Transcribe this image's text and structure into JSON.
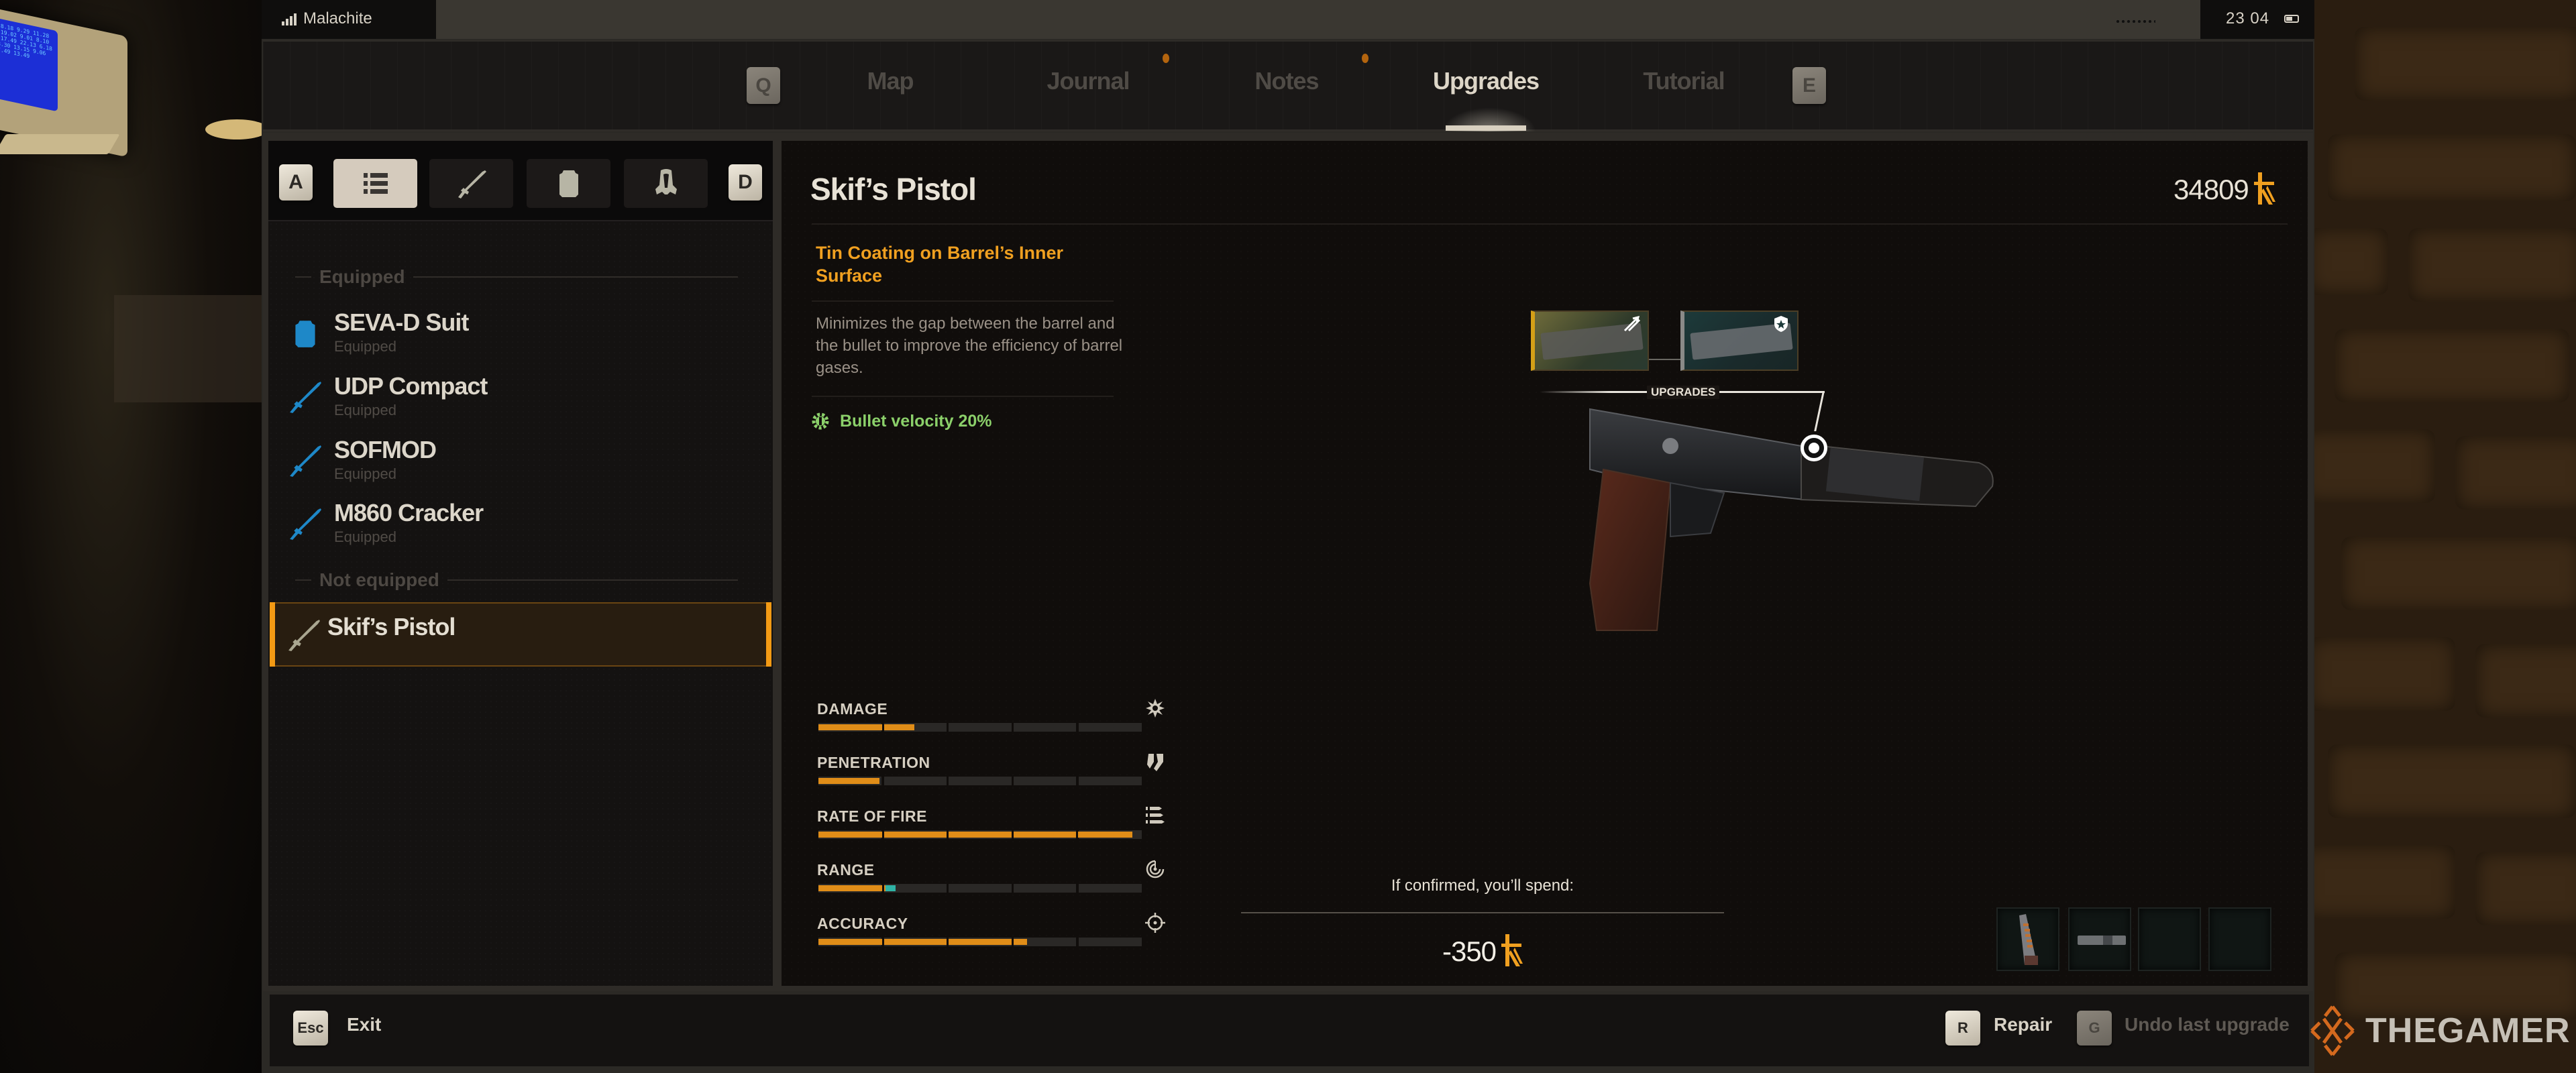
{
  "status_bar": {
    "carrier": "Malachite",
    "signal_icon": "signal-bars-icon",
    "time": "23 04",
    "battery_icon": "battery-icon"
  },
  "nav": {
    "prev_key": "Q",
    "next_key": "E",
    "tabs": [
      {
        "label": "Map",
        "active": false,
        "notification": false
      },
      {
        "label": "Journal",
        "active": false,
        "notification": true
      },
      {
        "label": "Notes",
        "active": false,
        "notification": true
      },
      {
        "label": "Upgrades",
        "active": true,
        "notification": false
      },
      {
        "label": "Tutorial",
        "active": false,
        "notification": false
      }
    ]
  },
  "sidebar": {
    "prev_key": "A",
    "next_key": "D",
    "categories": [
      {
        "name": "all",
        "icon": "list-icon",
        "active": true
      },
      {
        "name": "weapons",
        "icon": "rifle-icon",
        "active": false
      },
      {
        "name": "armor",
        "icon": "vest-icon",
        "active": false
      },
      {
        "name": "helmets",
        "icon": "gas-mask-icon",
        "active": false
      }
    ],
    "sections": [
      {
        "title": "Equipped",
        "items": [
          {
            "name": "SEVA-D Suit",
            "status": "Equipped",
            "icon": "vest-icon"
          },
          {
            "name": "UDP Compact",
            "status": "Equipped",
            "icon": "rifle-icon"
          },
          {
            "name": "SOFMOD",
            "status": "Equipped",
            "icon": "rifle-icon"
          },
          {
            "name": "M860 Cracker",
            "status": "Equipped",
            "icon": "rifle-icon"
          }
        ]
      },
      {
        "title": "Not equipped",
        "items": [
          {
            "name": "Skif’s Pistol",
            "status": "",
            "icon": "rifle-icon",
            "selected": true
          }
        ]
      }
    ]
  },
  "main": {
    "title": "Skif’s Pistol",
    "balance": "34809",
    "currency_icon": "coupon-currency-icon",
    "upgrade": {
      "name": "Tin Coating on Barrel’s Inner Surface",
      "description": "Minimizes the gap between the barrel and the bullet to improve the efficiency of barrel gases.",
      "bonus": "Bullet velocity 20%",
      "bonus_icon": "gear-wrench-icon"
    },
    "callout_label": "UPGRADES",
    "upgrade_thumbnails": [
      {
        "name": "barrel-upgrade",
        "badge_icon": "velocity-arrows-icon",
        "selected": true
      },
      {
        "name": "slide-upgrade",
        "badge_icon": "shield-burst-icon",
        "selected": false
      }
    ],
    "stats": [
      {
        "label": "DAMAGE",
        "icon": "explosion-icon",
        "value": 0.3,
        "bonus": 0
      },
      {
        "label": "PENETRATION",
        "icon": "penetration-icon",
        "value": 0.19,
        "bonus": 0
      },
      {
        "label": "RATE OF FIRE",
        "icon": "bullets-icon",
        "value": 0.98,
        "bonus": 0
      },
      {
        "label": "RANGE",
        "icon": "range-icon",
        "value": 0.21,
        "bonus": 0.03
      },
      {
        "label": "ACCURACY",
        "icon": "crosshair-icon",
        "value": 0.65,
        "bonus": 0
      }
    ],
    "stat_segments": 5,
    "cost": {
      "label": "If confirmed, you’ll spend:",
      "value": "-350"
    },
    "attachment_slots": [
      {
        "item": "magazine",
        "filled": true
      },
      {
        "item": "suppressor",
        "filled": true
      },
      {
        "item": "",
        "filled": false
      },
      {
        "item": "",
        "filled": false
      }
    ]
  },
  "footer": {
    "exit": {
      "key": "Esc",
      "label": "Exit",
      "enabled": true
    },
    "repair": {
      "key": "R",
      "label": "Repair",
      "enabled": true
    },
    "undo": {
      "key": "G",
      "label": "Undo last upgrade",
      "enabled": false
    }
  },
  "watermark": "THEGAMER",
  "colors": {
    "accent": "#f39a14",
    "upgrade_name": "#f0a020",
    "bonus": "#8bd06a",
    "bar_fill": "#e08d18",
    "bar_bonus": "#2fb3a5",
    "equipped_icon": "#1e88c8"
  }
}
